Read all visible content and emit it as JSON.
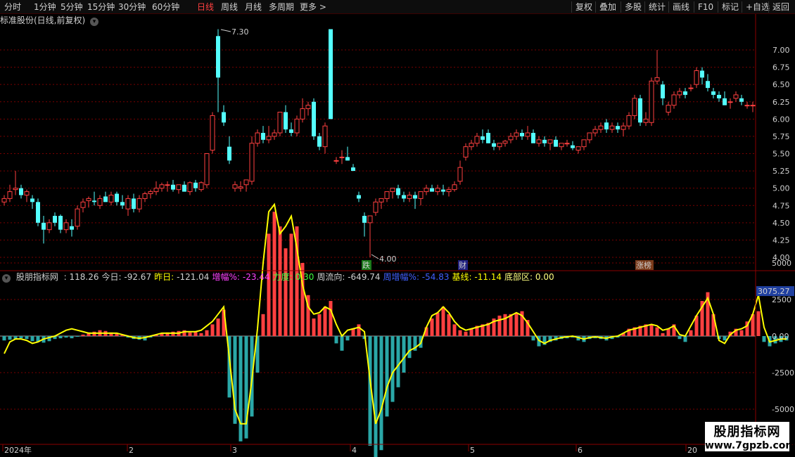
{
  "toolbar": {
    "left_items": [
      "分时",
      "1分钟",
      "5分钟",
      "15分钟",
      "30分钟",
      "60分钟",
      "日线",
      "周线",
      "月线",
      "多周期",
      "更多 >"
    ],
    "active_index": 6,
    "right_items": [
      "复权",
      "叠加",
      "多股",
      "统计",
      "画线",
      "F10",
      "标记",
      "+自选",
      "返回"
    ]
  },
  "main_chart": {
    "title": "标准股份(日线,前复权)",
    "y_ticks": [
      "7.00",
      "6.75",
      "6.50",
      "6.25",
      "6.00",
      "5.75",
      "5.50",
      "5.25",
      "5.00",
      "4.75",
      "4.50",
      "4.25",
      "4.00"
    ],
    "high_label": "7.30",
    "low_label": "4.00",
    "event_tags": [
      "跌",
      "财",
      "涨榜"
    ]
  },
  "indicator": {
    "name": "股朋指标网",
    "fields": [
      {
        "label": ": 118.26",
        "color": "#d0d0d0"
      },
      {
        "label": "今日: -92.67",
        "color": "#d0d0d0"
      },
      {
        "label": "昨日:",
        "color": "#ffff00"
      },
      {
        "label": "-121.04",
        "color": "#d0d0d0"
      },
      {
        "label": "增幅%:",
        "color": "#ff40ff"
      },
      {
        "label": "-23.44",
        "color": "#ff40ff"
      },
      {
        "label": "力度:",
        "color": "#40ff40"
      },
      {
        "label": "0.30",
        "color": "#40ff40"
      },
      {
        "label": "周流向: -649.74",
        "color": "#d0d0d0"
      },
      {
        "label": "周增幅%: -54.83",
        "color": "#4060ff"
      },
      {
        "label": "基线: -11.14",
        "color": "#ffff00"
      },
      {
        "label": "底部区: 0.00",
        "color": "#ffff80"
      }
    ],
    "y_ticks": [
      "5000",
      "2500",
      "0.00",
      "-2500",
      "-5000"
    ],
    "current_value": "3075.27"
  },
  "x_axis": {
    "labels": [
      "2024年",
      "2",
      "3",
      "4",
      "5",
      "6",
      "20"
    ]
  },
  "watermark": {
    "name": "股朋指标网",
    "url": "www.7gpzb.com"
  },
  "colors": {
    "up": "#ff4040",
    "down": "#54ffff",
    "line": "#ffff00",
    "grid": "#7a0000",
    "separator": "#8b0000"
  },
  "chart_data": {
    "type": "candlestick",
    "y_range": [
      4.0,
      7.0
    ],
    "candles": [
      [
        4.8,
        4.9,
        4.75,
        4.85
      ],
      [
        4.85,
        5.05,
        4.8,
        4.95
      ],
      [
        4.98,
        5.25,
        4.9,
        5.0
      ],
      [
        5.0,
        5.05,
        4.85,
        4.9
      ],
      [
        4.9,
        4.98,
        4.8,
        4.95
      ],
      [
        4.85,
        4.9,
        4.7,
        4.8
      ],
      [
        4.8,
        4.85,
        4.45,
        4.5
      ],
      [
        4.5,
        4.6,
        4.2,
        4.4
      ],
      [
        4.4,
        4.55,
        4.35,
        4.5
      ],
      [
        4.6,
        4.65,
        4.45,
        4.5
      ],
      [
        4.6,
        4.62,
        4.35,
        4.4
      ],
      [
        4.4,
        4.55,
        4.35,
        4.5
      ],
      [
        4.45,
        4.55,
        4.3,
        4.4
      ],
      [
        4.45,
        4.75,
        4.4,
        4.7
      ],
      [
        4.72,
        4.85,
        4.65,
        4.8
      ],
      [
        4.82,
        4.88,
        4.72,
        4.85
      ],
      [
        4.82,
        4.95,
        4.75,
        4.8
      ],
      [
        4.75,
        4.9,
        4.7,
        4.85
      ],
      [
        4.88,
        4.95,
        4.8,
        4.8
      ],
      [
        4.8,
        4.95,
        4.75,
        4.9
      ],
      [
        4.92,
        4.95,
        4.75,
        4.8
      ],
      [
        4.8,
        4.9,
        4.7,
        4.75
      ],
      [
        4.7,
        4.9,
        4.6,
        4.85
      ],
      [
        4.85,
        4.92,
        4.65,
        4.7
      ],
      [
        4.7,
        4.9,
        4.65,
        4.85
      ],
      [
        4.85,
        4.95,
        4.8,
        4.92
      ],
      [
        4.92,
        4.98,
        4.85,
        4.95
      ],
      [
        4.95,
        5.1,
        4.9,
        5.0
      ],
      [
        5.0,
        5.08,
        4.95,
        5.05
      ],
      [
        5.05,
        5.1,
        4.95,
        5.05
      ],
      [
        5.05,
        5.12,
        4.95,
        4.98
      ],
      [
        4.98,
        5.05,
        4.92,
        5.05
      ],
      [
        5.05,
        5.1,
        4.95,
        4.95
      ],
      [
        4.95,
        5.1,
        4.9,
        5.08
      ],
      [
        5.08,
        5.12,
        4.95,
        5.0
      ],
      [
        4.98,
        5.1,
        4.95,
        5.08
      ],
      [
        5.05,
        5.4,
        5.0,
        5.5
      ],
      [
        5.55,
        6.1,
        5.5,
        6.05
      ],
      [
        7.2,
        7.3,
        6.1,
        6.6
      ],
      [
        6.1,
        6.2,
        5.9,
        5.95
      ],
      [
        5.6,
        5.75,
        5.35,
        5.4
      ],
      [
        5.0,
        5.1,
        4.95,
        5.05
      ],
      [
        5.0,
        5.1,
        4.95,
        5.02
      ],
      [
        5.05,
        5.1,
        4.95,
        5.12
      ],
      [
        5.1,
        5.75,
        5.05,
        5.65
      ],
      [
        5.65,
        5.85,
        5.6,
        5.8
      ],
      [
        5.8,
        5.9,
        5.65,
        5.7
      ],
      [
        5.7,
        5.9,
        5.65,
        5.75
      ],
      [
        5.75,
        5.85,
        5.7,
        5.8
      ],
      [
        5.8,
        6.05,
        5.75,
        6.1
      ],
      [
        6.1,
        6.2,
        5.8,
        5.85
      ],
      [
        5.85,
        5.95,
        5.75,
        5.8
      ],
      [
        5.8,
        6.05,
        5.75,
        6.0
      ],
      [
        6.0,
        6.3,
        5.95,
        6.15
      ],
      [
        6.15,
        6.25,
        6.05,
        6.2
      ],
      [
        6.25,
        6.3,
        5.7,
        5.75
      ],
      [
        5.75,
        5.8,
        5.55,
        5.6
      ],
      [
        5.6,
        5.95,
        5.5,
        5.9
      ],
      [
        7.3,
        7.3,
        6.0,
        6.0
      ],
      [
        5.4,
        5.45,
        5.35,
        5.4
      ],
      [
        5.45,
        5.55,
        5.35,
        5.45
      ],
      [
        5.45,
        5.6,
        5.4,
        5.4
      ],
      [
        5.3,
        5.35,
        5.25,
        5.25
      ],
      [
        4.9,
        4.95,
        4.8,
        4.85
      ],
      [
        4.6,
        4.65,
        4.3,
        4.5
      ],
      [
        4.5,
        4.6,
        4.0,
        4.6
      ],
      [
        4.65,
        4.85,
        4.6,
        4.8
      ],
      [
        4.8,
        4.85,
        4.7,
        4.85
      ],
      [
        4.85,
        4.95,
        4.8,
        4.95
      ],
      [
        4.95,
        5.0,
        4.85,
        5.0
      ],
      [
        5.0,
        5.05,
        4.85,
        4.9
      ],
      [
        4.9,
        4.95,
        4.8,
        4.85
      ],
      [
        4.85,
        4.95,
        4.8,
        4.9
      ],
      [
        4.9,
        4.95,
        4.7,
        4.85
      ],
      [
        4.85,
        4.95,
        4.75,
        4.95
      ],
      [
        4.95,
        5.05,
        4.9,
        5.0
      ],
      [
        5.0,
        5.05,
        4.95,
        4.95
      ],
      [
        4.95,
        5.05,
        4.9,
        5.0
      ],
      [
        4.98,
        5.05,
        4.9,
        4.95
      ],
      [
        4.95,
        5.02,
        4.88,
        4.98
      ],
      [
        4.98,
        5.1,
        4.95,
        5.05
      ],
      [
        5.1,
        5.4,
        5.05,
        5.3
      ],
      [
        5.45,
        5.65,
        5.4,
        5.6
      ],
      [
        5.6,
        5.7,
        5.55,
        5.65
      ],
      [
        5.65,
        5.8,
        5.6,
        5.75
      ],
      [
        5.75,
        5.85,
        5.65,
        5.7
      ],
      [
        5.8,
        5.85,
        5.65,
        5.65
      ],
      [
        5.65,
        5.7,
        5.55,
        5.6
      ],
      [
        5.6,
        5.65,
        5.55,
        5.65
      ],
      [
        5.65,
        5.7,
        5.6,
        5.68
      ],
      [
        5.7,
        5.8,
        5.65,
        5.75
      ],
      [
        5.75,
        5.85,
        5.7,
        5.8
      ],
      [
        5.8,
        5.85,
        5.7,
        5.75
      ],
      [
        5.75,
        5.9,
        5.7,
        5.8
      ],
      [
        5.8,
        5.85,
        5.7,
        5.65
      ],
      [
        5.65,
        5.75,
        5.6,
        5.7
      ],
      [
        5.7,
        5.75,
        5.6,
        5.65
      ],
      [
        5.65,
        5.7,
        5.55,
        5.7
      ],
      [
        5.7,
        5.75,
        5.6,
        5.6
      ],
      [
        5.6,
        5.65,
        5.55,
        5.65
      ],
      [
        5.65,
        5.7,
        5.6,
        5.65
      ],
      [
        5.62,
        5.68,
        5.55,
        5.58
      ],
      [
        5.55,
        5.6,
        5.5,
        5.6
      ],
      [
        5.6,
        5.7,
        5.55,
        5.7
      ],
      [
        5.7,
        5.8,
        5.65,
        5.8
      ],
      [
        5.8,
        5.9,
        5.75,
        5.85
      ],
      [
        5.85,
        5.95,
        5.8,
        5.9
      ],
      [
        5.95,
        6.0,
        5.8,
        5.85
      ],
      [
        5.85,
        5.95,
        5.8,
        5.9
      ],
      [
        5.9,
        5.95,
        5.8,
        5.85
      ],
      [
        5.85,
        5.95,
        5.75,
        5.9
      ],
      [
        5.9,
        6.1,
        5.85,
        6.05
      ],
      [
        6.05,
        6.35,
        6.0,
        6.3
      ],
      [
        6.3,
        6.35,
        5.9,
        5.95
      ],
      [
        5.95,
        6.1,
        5.9,
        6.0
      ],
      [
        5.95,
        6.6,
        5.9,
        6.55
      ],
      [
        6.55,
        7.0,
        6.5,
        6.6
      ],
      [
        6.5,
        6.55,
        6.2,
        6.3
      ],
      [
        6.1,
        6.25,
        6.05,
        6.2
      ],
      [
        6.2,
        6.4,
        6.15,
        6.35
      ],
      [
        6.35,
        6.45,
        6.3,
        6.4
      ],
      [
        6.4,
        6.45,
        6.3,
        6.35
      ],
      [
        6.45,
        6.5,
        6.4,
        6.45
      ],
      [
        6.5,
        6.75,
        6.45,
        6.7
      ],
      [
        6.7,
        6.75,
        6.5,
        6.6
      ],
      [
        6.55,
        6.65,
        6.4,
        6.45
      ],
      [
        6.4,
        6.45,
        6.3,
        6.35
      ],
      [
        6.35,
        6.4,
        6.25,
        6.3
      ],
      [
        6.3,
        6.4,
        6.2,
        6.2
      ],
      [
        6.25,
        6.3,
        6.15,
        6.25
      ],
      [
        6.3,
        6.4,
        6.25,
        6.35
      ],
      [
        6.3,
        6.35,
        6.2,
        6.25
      ],
      [
        6.2,
        6.25,
        6.15,
        6.2
      ],
      [
        6.2,
        6.25,
        6.1,
        6.2
      ]
    ],
    "indicator_bars": [
      -300,
      -250,
      -200,
      -150,
      -200,
      -350,
      -400,
      -450,
      -350,
      -200,
      -150,
      -100,
      -150,
      -50,
      100,
      250,
      300,
      400,
      350,
      250,
      150,
      100,
      -100,
      -200,
      -250,
      -300,
      -100,
      100,
      200,
      250,
      300,
      350,
      400,
      250,
      300,
      200,
      400,
      800,
      1200,
      1800,
      -4200,
      -6000,
      -7200,
      -7000,
      -5500,
      -2500,
      1500,
      7000,
      8500,
      7500,
      6000,
      7000,
      7500,
      5000,
      2800,
      1200,
      1500,
      2000,
      2400,
      -500,
      -1000,
      -300,
      500,
      800,
      -200,
      -7500,
      -9000,
      -7800,
      -5500,
      -4500,
      -3500,
      -2500,
      -1500,
      -1000,
      -800,
      600,
      1200,
      1600,
      2000,
      1500,
      800,
      400,
      300,
      500,
      700,
      800,
      900,
      1200,
      1400,
      1500,
      1500,
      1600,
      1700,
      1100,
      -300,
      -700,
      -600,
      -400,
      -300,
      -200,
      -150,
      -100,
      -300,
      -400,
      -200,
      -150,
      -200,
      -300,
      -200,
      -100,
      200,
      500,
      600,
      700,
      800,
      800,
      600,
      200,
      500,
      800,
      -200,
      -400,
      400,
      1400,
      2400,
      3000,
      1500,
      -200,
      -300,
      300,
      500,
      400,
      1000,
      1500,
      1700,
      -400,
      -700,
      -500,
      -400,
      -300
    ],
    "indicator_line": [
      -1200,
      -400,
      -200,
      -200,
      -300,
      -500,
      -400,
      -200,
      -100,
      0,
      200,
      400,
      500,
      400,
      300,
      200,
      200,
      200,
      200,
      200,
      200,
      100,
      0,
      -100,
      -150,
      -100,
      0,
      100,
      200,
      200,
      200,
      200,
      300,
      300,
      300,
      400,
      700,
      1000,
      1500,
      2000,
      -1500,
      -5000,
      -6000,
      -6000,
      -3000,
      500,
      5000,
      8500,
      9000,
      7000,
      7500,
      8200,
      6000,
      3500,
      2000,
      1500,
      1600,
      2000,
      1800,
      800,
      0,
      400,
      500,
      600,
      300,
      -3000,
      -6000,
      -5000,
      -3500,
      -2500,
      -2000,
      -1500,
      -1000,
      -800,
      -500,
      600,
      1400,
      1600,
      2000,
      1600,
      1000,
      600,
      400,
      500,
      600,
      700,
      800,
      1000,
      1100,
      1200,
      1400,
      1600,
      1400,
      900,
      300,
      -300,
      -500,
      -300,
      -200,
      -100,
      -50,
      0,
      -100,
      -200,
      -100,
      -50,
      -100,
      -150,
      -50,
      0,
      200,
      400,
      500,
      600,
      700,
      800,
      700,
      400,
      500,
      700,
      100,
      0,
      700,
      1400,
      2000,
      2600,
      1500,
      -300,
      -500,
      100,
      400,
      500,
      700,
      1500,
      2800,
      600,
      -400,
      -300,
      -200,
      -200
    ]
  }
}
